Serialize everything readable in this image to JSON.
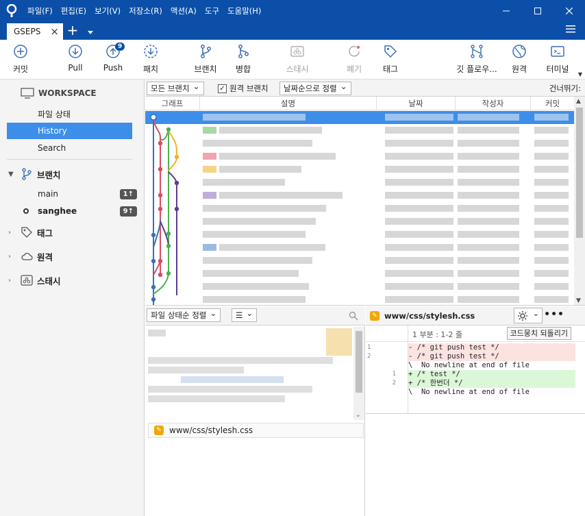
{
  "menu": [
    "파일(F)",
    "편집(E)",
    "보기(V)",
    "저장소(R)",
    "액션(A)",
    "도구",
    "도움말(H)"
  ],
  "tab": {
    "label": "GSEPS"
  },
  "toolbar": {
    "commit": "커밋",
    "pull": "Pull",
    "push": "Push",
    "push_badge": "9",
    "fetch": "패치",
    "branch": "브랜치",
    "merge": "병합",
    "stash": "스태시",
    "discard": "폐기",
    "tag": "태그",
    "git_flow": "깃 플로우...",
    "remote": "원격",
    "terminal": "터미널"
  },
  "sidebar": {
    "workspace": "WORKSPACE",
    "items": [
      "파일 상태",
      "History",
      "Search"
    ],
    "branches_label": "브랜치",
    "branches": [
      {
        "name": "main",
        "ahead": "1↑"
      },
      {
        "name": "sanghee",
        "ahead": "9↑"
      }
    ],
    "tags_label": "태그",
    "remotes_label": "원격",
    "stashes_label": "스태시"
  },
  "filter": {
    "branches_dropdown": "모든 브랜치",
    "remote_branches_checkbox": "원격 브랜치",
    "sort_dropdown": "날짜순으로 정렬",
    "skip_label": "건너뛰기:"
  },
  "commit_table": {
    "columns": [
      "그래프",
      "설명",
      "날짜",
      "작성자",
      "커밋"
    ]
  },
  "files_pane": {
    "sort_dropdown": "파일 상태순 정렬",
    "view_dropdown": "☰",
    "file": "www/css/stylesh.css"
  },
  "diff": {
    "file": "www/css/stylesh.css",
    "hunk_label": "1 부분 : 1-2 줄",
    "hunk_button": "코드뭉치 되돌리기",
    "lines": [
      {
        "type": "del",
        "old": "1",
        "new": "",
        "text": "- /* git push test */"
      },
      {
        "type": "del",
        "old": "2",
        "new": "",
        "text": "- /* git push test */"
      },
      {
        "type": "ctx",
        "old": "",
        "new": "",
        "text": "\\  No newline at end of file"
      },
      {
        "type": "add",
        "old": "",
        "new": "1",
        "text": "+ /* test */"
      },
      {
        "type": "add",
        "old": "",
        "new": "2",
        "text": "+ /* 한번더 */"
      },
      {
        "type": "ctx",
        "old": "",
        "new": "",
        "text": "\\  No newline at end of file"
      }
    ]
  },
  "colors": {
    "titlebar": "#0b4fa8",
    "selection": "#3d8ee8",
    "graph_blue": "#3b6fb6",
    "graph_red": "#d94a63",
    "graph_green": "#4caf50",
    "graph_yellow": "#f0b429",
    "graph_purple": "#5a3d8a"
  }
}
